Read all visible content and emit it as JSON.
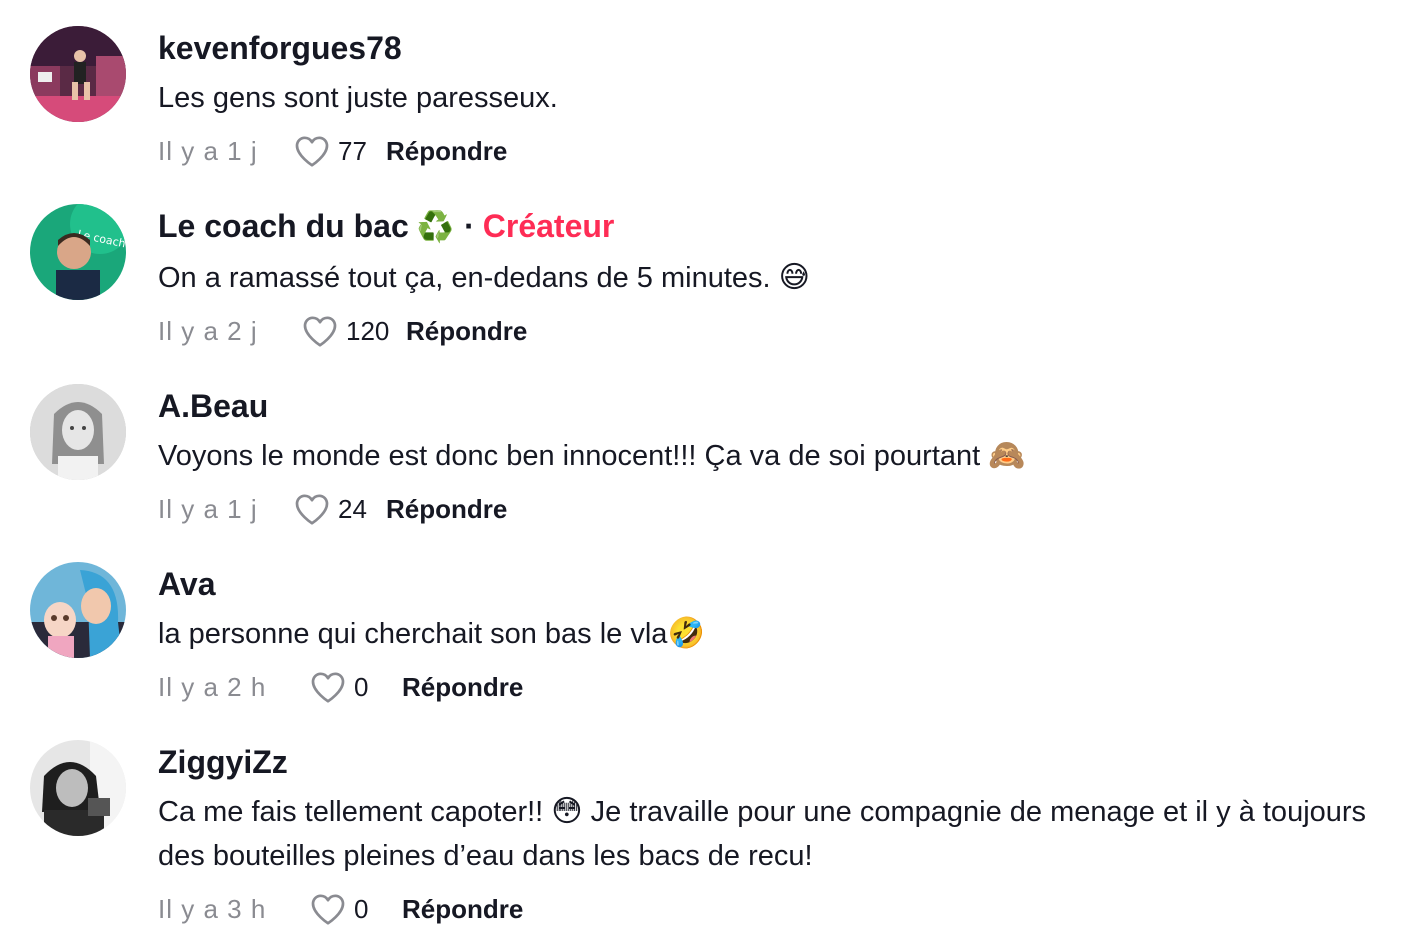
{
  "comments": [
    {
      "username": "kevenforgues78",
      "text": "Les gens sont juste paresseux.",
      "time": "Il y a 1 j",
      "likes": "77",
      "reply": "Répondre"
    },
    {
      "username": "Le coach du bac",
      "badge": "♻️",
      "separator": "·",
      "role": "Créateur",
      "text": "On a ramassé tout ça, en-dedans de 5 minutes.",
      "emoji": "😅",
      "time": "Il y a 2 j",
      "likes": "120",
      "reply": "Répondre",
      "avatar_text": "Le coach du bac"
    },
    {
      "username": "A.Beau",
      "text": "Voyons le monde est donc ben innocent!!! Ça va de soi pourtant",
      "emoji": "🙈",
      "time": "Il y a 1 j",
      "likes": "24",
      "reply": "Répondre"
    },
    {
      "username": "Ava",
      "text": "la personne qui cherchait son bas le vla",
      "emoji": "🤣",
      "time": "Il y a 2 h",
      "likes": "0",
      "reply": "Répondre"
    },
    {
      "username": "ZiggyiZz",
      "text_part1": "Ca me fais tellement capoter!!",
      "emoji": "😳",
      "text_part2": "Je travaille pour une compagnie de menage et il y à toujours des bouteilles pleines d’eau dans les bacs de recu!",
      "time": "Il y a 3 h",
      "likes": "0",
      "reply": "Répondre"
    }
  ],
  "colors": {
    "creator": "#fe2c55",
    "muted": "#8a8b91",
    "text": "#161823"
  }
}
